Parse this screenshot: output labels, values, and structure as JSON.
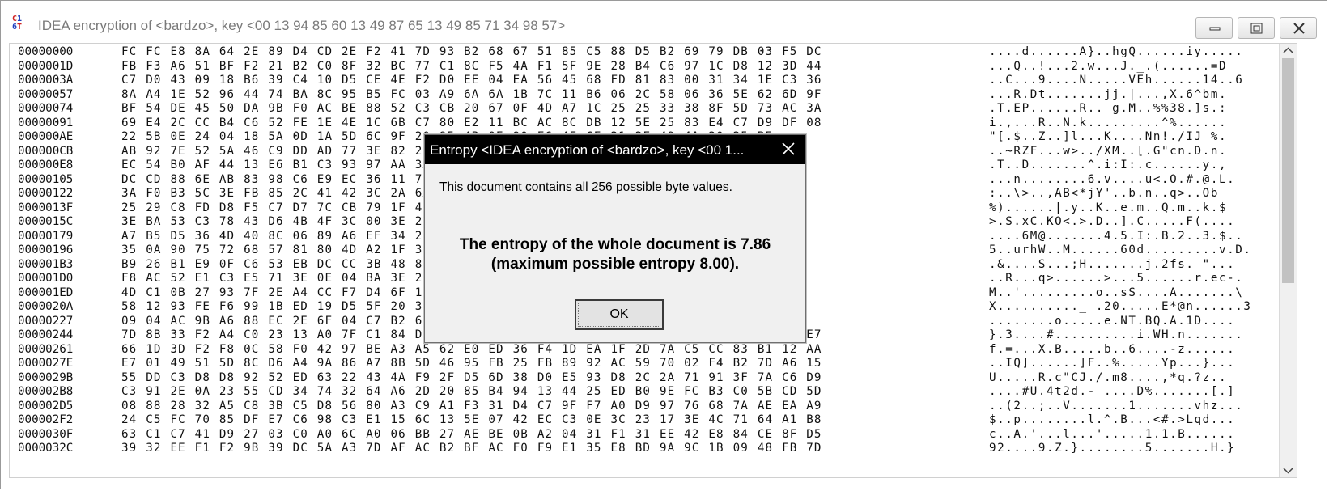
{
  "window": {
    "title": "IDEA encryption of <bardzo>, key <00 13 94 85 60 13 49 87 65 13 49 85 71 34 98 57>",
    "icon": "hex-editor-app-icon",
    "controls": [
      "minimize-icon",
      "maximize-icon",
      "close-icon"
    ]
  },
  "hex_rows": [
    {
      "addr": "00000000",
      "bytes": "FC FC E8 8A 64 2E 89 D4 CD 2E F2 41 7D 93 B2 68 67 51 85 C5 88 D5 B2 69 79 DB 03 F5 DC",
      "ascii": "....d......A}..hgQ......iy....."
    },
    {
      "addr": "0000001D",
      "bytes": "FB F3 A6 51 BF F2 21 B2 C0 8F 32 BC 77 C1 8C F5 4A F1 5F 9E 28 B4 C6 97 1C D8 12 3D 44",
      "ascii": "...Q..!...2.w...J._.(......=D"
    },
    {
      "addr": "0000003A",
      "bytes": "C7 D0 43 09 18 B6 39 C4 10 D5 CE 4E F2 D0 EE 04 EA 56 45 68 FD 81 83 00 31 34 1E C3 36",
      "ascii": "..C...9....N.....VEh......14..6"
    },
    {
      "addr": "00000057",
      "bytes": "8A A4 1E 52 96 44 74 BA 8C 95 B5 FC 03 A9 6A 6A 1B 7C 11 B6 06 2C 58 06 36 5E 62 6D 9F",
      "ascii": "...R.Dt.......jj.|...,X.6^bm."
    },
    {
      "addr": "00000074",
      "bytes": "BF 54 DE 45 50 DA 9B F0 AC BE 88 52 C3 CB 20 67 0F 4D A7 1C 25 25 33 38 8F 5D 73 AC 3A",
      "ascii": ".T.EP......R.. g.M..%%38.]s.:"
    },
    {
      "addr": "00000091",
      "bytes": "69 E4 2C CC B4 C6 52 FE 1E 4E 1C 6B C7 80 E2 11 BC AC 8C DB 12 5E 25 83 E4 C7 D9 DF 08",
      "ascii": "i.,...R..N.k.........^%......"
    },
    {
      "addr": "000000AE",
      "bytes": "22 5B 0E 24 04 18 5A 0D 1A 5D 6C 9F 20 95 4B 0E 90 E6 4E 6E 21 2F 49 4A 20 25 B5",
      "ascii": "\"[.$..Z..]l...K....Nn!./IJ %."
    },
    {
      "addr": "000000CB",
      "bytes": "AB 92 7E 52 5A 46 C9 DD AD 77 3E 82 2F 58 4D AD 9B 5B 47 22 63 6E 0E 44 0C 6E C0",
      "ascii": "..~RZF...w>../XM..[.G\"cn.D.n."
    },
    {
      "addr": "000000E8",
      "bytes": "EC 54 B0 AF 44 13 E6 B1 C3 93 97 AA 3A 69 3A 49 3A 63 2E 8A CE B9 79 09 2C",
      "ascii": ".T..D.......^.i:I:.c......y.,"
    },
    {
      "addr": "00000105",
      "bytes": "DC CD 88 6E AB 83 98 C6 E9 EC 36 11 76 00 75 3C 8F 4F 8E 23 BD 40 A2 4C C9",
      "ascii": "...n........6.v....u<.O.#.@.L."
    },
    {
      "addr": "00000122",
      "bytes": "3A F0 B3 5C 3E FB 85 2C 41 42 3C 2A 6A 59 27 1C 62 0A 6E 3E FA E6 4F 62",
      "ascii": ":..\\>..,AB<*jY'..b.n..q>..Ob"
    },
    {
      "addr": "0000013F",
      "bytes": "25 29 C8 FD D8 F5 C7 D7 7C CB 79 1F 4B 8F 65 1C 6D 1C 51 92 BD 6B 86 24",
      "ascii": "%)......|.y..K..e.m..Q.m..k.$"
    },
    {
      "addr": "0000015C",
      "bytes": "3E BA 53 C3 78 43 D6 4B 4F 3C 00 3E 2E 44 9C 43 C5 2E 46 28 BC 98 04 C8",
      "ascii": ">.S.xC.KO<.>.D..].C.....F(...."
    },
    {
      "addr": "00000179",
      "bytes": "A7 B5 D5 36 4D 40 8C 06 89 A6 EF 34 2E 35 A3 49 3A 42 E3 33 07 24 DC C0",
      "ascii": "....6M@.......4.5.I:.B.2..3.$.."
    },
    {
      "addr": "00000196",
      "bytes": "35 0A 90 75 72 68 57 81 80 4D A2 1F 36 30 64 19 B9 02 93 76 95 44 C1",
      "ascii": "5..urhW..M......60d.........v.D."
    },
    {
      "addr": "000001B3",
      "bytes": "B9 26 B1 E9 0F C6 53 EB DC CC 3B 48 83 F0 AC 20 6A 2E 20 22 CE A4 EC",
      "ascii": ".&....S...;H.......j.2fs. \"..."
    },
    {
      "addr": "000001D0",
      "bytes": "F8 AC 52 E1 C3 E5 71 3E 0E 04 BA 3E 2E 35 92 DE 2E 72 A8 65 63 2D F5",
      "ascii": "..R...q>......>...5......r.ec-."
    },
    {
      "addr": "000001ED",
      "bytes": "4D C1 0B 27 93 7F 2E A4 CC F7 D4 6F 1B 73 53 D3 41 8C 18 C1 09 A3 5C",
      "ascii": "M..'.........o..sS....A.......\\"
    },
    {
      "addr": "0000020A",
      "bytes": "58 12 93 FE F6 99 1B ED 19 D5 5F 20 32 30 CB 10 45 2A C9 12 9E B5 33",
      "ascii": "X.........._ .20.....E*@n......3"
    },
    {
      "addr": "00000227",
      "bytes": "09 04 AC 9B A6 88 EC 2E 6F 04 C7 B2 65 2E 4E 54 42 51 44 84 15 11 D9",
      "ascii": "........o.....e.NT.BQ.A.1D...."
    },
    {
      "addr": "00000244",
      "bytes": "7D 8B 33 F2 A4 C0 23 13 A0 7F C1 84 DD C2 82 80 69 A6 57 48 BB 6E B3 8F DB AF 89 0D E7",
      "ascii": "}.3....#..........i.WH.n......."
    },
    {
      "addr": "00000261",
      "bytes": "66 1D 3D F2 F8 0C 58 F0 42 97 BE A3 A5 62 E0 ED 36 F4 1D EA 1F 2D 7A C5 CC 83 B1 12 AA",
      "ascii": "f.=...X.B.....b..6....-z......"
    },
    {
      "addr": "0000027E",
      "bytes": "E7 01 49 51 5D 8C D6 A4 9A 86 A7 8B 5D 46 95 FB 25 FB 89 92 AC 59 70 02 F4 B2 7D A6 15",
      "ascii": "..IQ]......]F..%.....Yp...}..."
    },
    {
      "addr": "0000029B",
      "bytes": "55 DD C3 D8 D8 92 52 ED 63 22 43 4A F9 2F D5 6D 38 D0 E5 93 D8 2C 2A 71 91 3F 7A C6 D9",
      "ascii": "U.....R.c\"CJ./.m8....,*q.?z.."
    },
    {
      "addr": "000002B8",
      "bytes": "C3 91 2E 0A 23 55 CD 34 74 32 64 A6 2D 20 85 B4 94 13 44 25 ED B0 9E FC B3 C0 5B CD 5D",
      "ascii": "....#U.4t2d.- ....D%.......[.]"
    },
    {
      "addr": "000002D5",
      "bytes": "08 88 28 32 A5 C8 3B C5 D8 56 80 A3 C9 A1 F3 31 D4 C7 9F F7 A0 D9 97 76 68 7A AE EA A9",
      "ascii": "..(2..;..V.......1.......vhz..."
    },
    {
      "addr": "000002F2",
      "bytes": "24 C5 FC 70 85 DF E7 C6 98 C3 E1 15 6C 13 5E 07 42 EC C3 0E 3C 23 17 3E 4C 71 64 A1 B8",
      "ascii": "$..p........l.^.B...<#.>Lqd..."
    },
    {
      "addr": "0000030F",
      "bytes": "63 C1 C7 41 D9 27 03 C0 A0 6C A0 06 BB 27 AE BE 0B A2 04 31 F1 31 EE 42 E8 84 CE 8F D5",
      "ascii": "c..A.'...l...'.....1.1.B......"
    },
    {
      "addr": "0000032C",
      "bytes": "39 32 EE F1 F2 9B 39 DC 5A A3 7D AF AC B2 BF AC F0 F9 E1 35 E8 BD 9A 9C 1B 09 48 FB 7D",
      "ascii": "92....9.Z.}........5.......H.}"
    }
  ],
  "dialog": {
    "title": "Entropy <IDEA encryption of <bardzo>, key <00 1...",
    "message": "This document contains all 256 possible byte values.",
    "entropy_line1": "The entropy of the whole document is 7.86",
    "entropy_line2": "(maximum possible entropy 8.00).",
    "ok_label": "OK",
    "entropy_value": 7.86,
    "max_entropy": 8.0
  },
  "colors": {
    "dialog_titlebar": "#000000",
    "dialog_background": "#f0f0f0",
    "app_icon_red": "#d02020",
    "app_icon_blue": "#1f3fbf"
  }
}
